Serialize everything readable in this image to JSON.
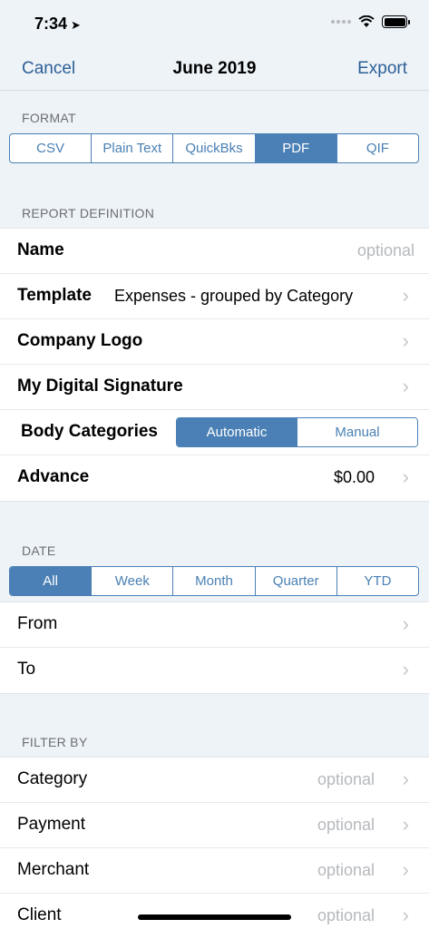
{
  "status": {
    "time": "7:34"
  },
  "nav": {
    "cancel": "Cancel",
    "title": "June 2019",
    "export": "Export"
  },
  "format": {
    "header": "FORMAT",
    "options": [
      "CSV",
      "Plain Text",
      "QuickBks",
      "PDF",
      "QIF"
    ],
    "selected": "PDF"
  },
  "report": {
    "header": "REPORT DEFINITION",
    "name_label": "Name",
    "name_placeholder": "optional",
    "template_label": "Template",
    "template_value": "Expenses - grouped by Category",
    "logo_label": "Company Logo",
    "signature_label": "My Digital Signature",
    "body_label": "Body Categories",
    "body_options": [
      "Automatic",
      "Manual"
    ],
    "body_selected": "Automatic",
    "advance_label": "Advance",
    "advance_value": "$0.00"
  },
  "date": {
    "header": "DATE",
    "options": [
      "All",
      "Week",
      "Month",
      "Quarter",
      "YTD"
    ],
    "selected": "All",
    "from_label": "From",
    "to_label": "To"
  },
  "filter": {
    "header": "FILTER BY",
    "category_label": "Category",
    "payment_label": "Payment",
    "merchant_label": "Merchant",
    "client_label": "Client",
    "placeholder": "optional"
  },
  "colors": {
    "accent": "#4a80b5",
    "nav_text": "#2d5f96"
  }
}
